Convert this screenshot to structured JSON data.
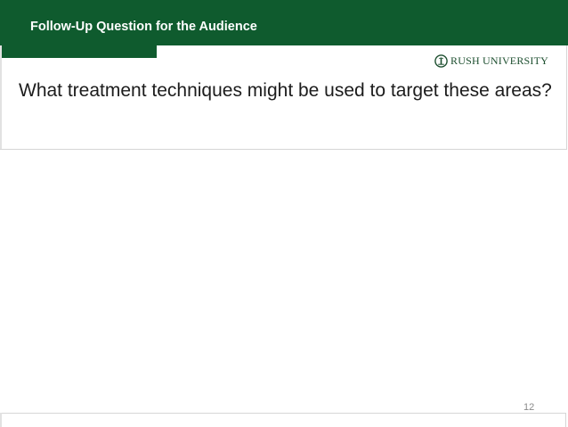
{
  "header": {
    "title": "Follow-Up Question for the Audience",
    "background_color": "#0f5b2e",
    "text_color": "#ffffff"
  },
  "logo": {
    "text": "RUSH UNIVERSITY",
    "icon": "rush-tree-icon",
    "color": "#1d4f2f"
  },
  "content": {
    "question": "What treatment techniques might be used to target these areas?"
  },
  "footer": {
    "page_number": "12"
  }
}
